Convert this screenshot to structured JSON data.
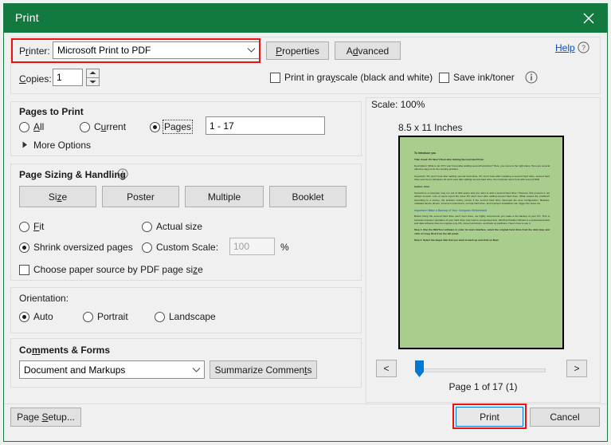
{
  "window": {
    "title": "Print",
    "close_icon": "close-icon",
    "accent_color": "#12793f"
  },
  "printer": {
    "label": "Printer:",
    "selected": "Microsoft Print to PDF",
    "dropdown_icon": "chevron-down-icon",
    "properties_label": "Properties",
    "advanced_label": "Advanced",
    "help_label": "Help",
    "help_icon": "question-circle-icon"
  },
  "copies": {
    "label": "Copies:",
    "value": "1",
    "spinner_up_icon": "caret-up-icon",
    "spinner_down_icon": "caret-down-icon"
  },
  "print_options": {
    "grayscale_label": "Print in grayscale (black and white)",
    "grayscale_checked": false,
    "save_ink_label": "Save ink/toner",
    "save_ink_checked": false,
    "info_icon": "info-circle-icon"
  },
  "pages_to_print": {
    "title": "Pages to Print",
    "options": [
      {
        "label": "All",
        "selected": false
      },
      {
        "label": "Current",
        "selected": false
      },
      {
        "label": "Pages",
        "selected": true
      }
    ],
    "pages_value": "1 - 17",
    "more_options_label": "More Options",
    "more_options_icon": "triangle-right-icon"
  },
  "page_sizing": {
    "title": "Page Sizing & Handling",
    "info_icon": "info-circle-icon",
    "buttons": [
      "Size",
      "Poster",
      "Multiple",
      "Booklet"
    ],
    "options": [
      {
        "label": "Fit",
        "selected": false
      },
      {
        "label": "Actual size",
        "selected": false
      },
      {
        "label": "Shrink oversized pages",
        "selected": true
      },
      {
        "label": "Custom Scale:",
        "selected": false
      }
    ],
    "custom_scale_value": "100",
    "percent_label": "%",
    "paper_source_label": "Choose paper source by PDF page size",
    "paper_source_checked": false
  },
  "orientation": {
    "title": "Orientation:",
    "options": [
      {
        "label": "Auto",
        "selected": true
      },
      {
        "label": "Portrait",
        "selected": false
      },
      {
        "label": "Landscape",
        "selected": false
      }
    ]
  },
  "comments_forms": {
    "title": "Comments & Forms",
    "selected": "Document and Markups",
    "dropdown_icon": "chevron-down-icon",
    "summarize_label": "Summarize Comments"
  },
  "preview": {
    "scale_text": "Scale: 100%",
    "paper_size_text": "8.5 x 11 Inches",
    "prev_label": "<",
    "next_label": ">",
    "page_indicator": "Page 1 of 17 (1)",
    "page_background": "#a8cd8c",
    "document": {
      "heading": "To Introduce you",
      "lines": [
        "Title: Fixed: PC Won't Boot after Adding Second Hard Drive",
        "Description: What to do if PC won't boot after adding second hard drive? Here, you come to the right place. Here are several effective ways to fix the booting problem.",
        "Keywords: PC won't boot after adding second hard drive, PC won't boot after installing a second hard drive, second hard drive won't boot, Windows 10 won't boot after adding second hard drive, the computer won't boot with second HDD",
        "Author: Ariel"
      ],
      "author_paragraph": "Sometimes a computer may run out of disk space and you want to add a second hard drive. However, this process is not always smooth. Lots of users report the issue PC won't boot after adding second hard drive. What causes the problem? According to a survey, the problem mainly occurs if the second hard drive interrupts the boot configuration. Besides, outdated device drivers, incorrect connections, corrupt hard drive, and improper installation can trigger the issue too.",
      "subheading": "Important! Make a Backup of Your Computer Beforehand",
      "backup_paragraph": "Before fixing the second hard drive won't boot issue, we highly recommend you make a full backup of your PC. This is because improper operation of your hard drive may lead to unexpected loss. MiniTool Partition Wizard is a professional disk and data software that can migrate only OS, clone hard drives, and back up partitions. Here's how to use it.",
      "steps": [
        "Step 1. Run the MiniTool software to enter its main interface, select the original hard drive from the disk map, and click on Copy Disk from the left panel.",
        "Step 2. Select the target disk that you want to back up and click on Next."
      ]
    }
  },
  "footer": {
    "page_setup_label": "Page Setup...",
    "print_label": "Print",
    "cancel_label": "Cancel"
  },
  "annotations": {
    "printer_highlight_color": "#ee1111",
    "print_button_highlight_color": "#ee1111"
  }
}
